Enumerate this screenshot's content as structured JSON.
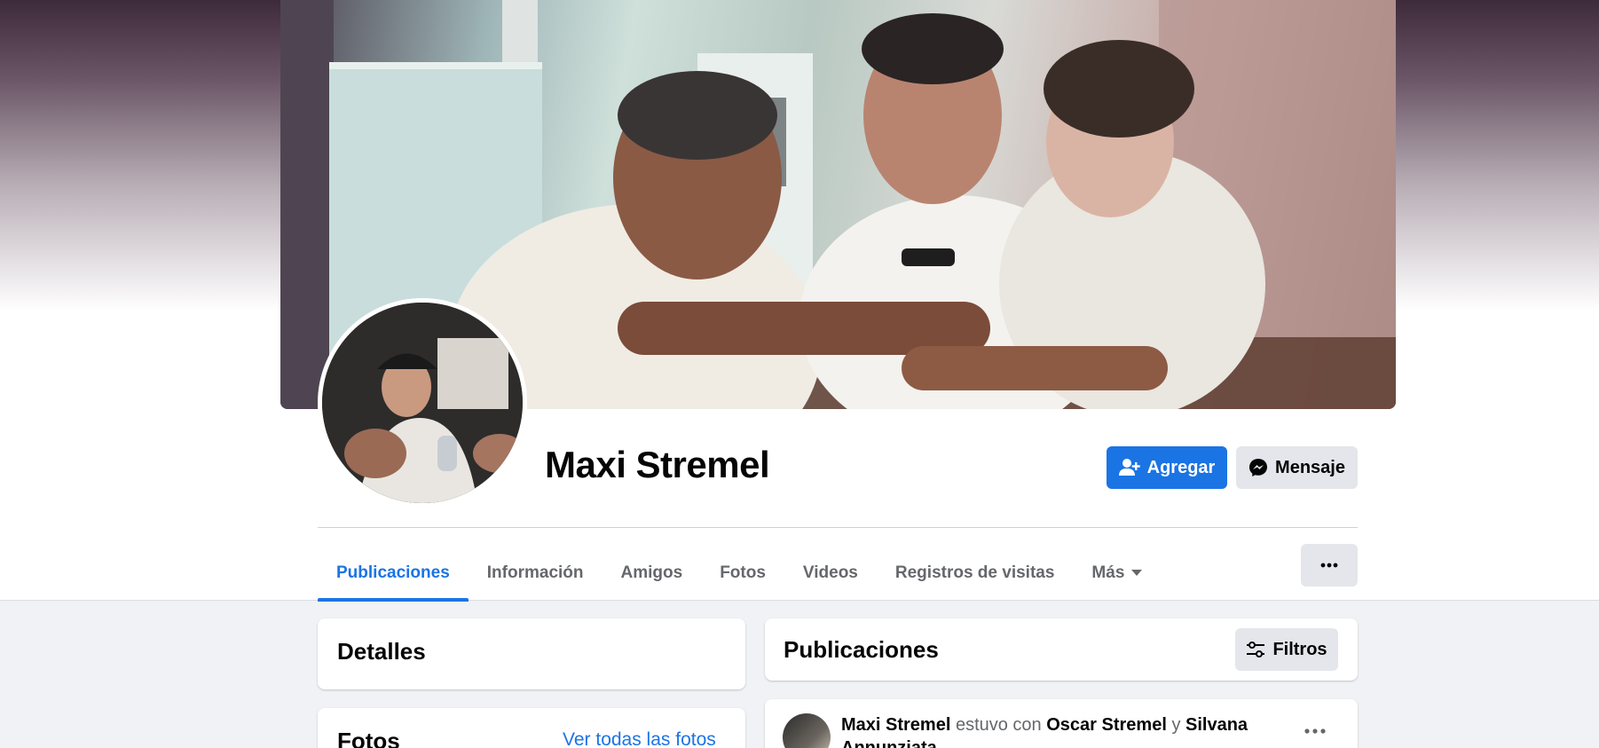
{
  "profile": {
    "name": "Maxi Stremel",
    "add_label": "Agregar",
    "message_label": "Mensaje"
  },
  "tabs": [
    {
      "label": "Publicaciones",
      "active": true
    },
    {
      "label": "Información",
      "active": false
    },
    {
      "label": "Amigos",
      "active": false
    },
    {
      "label": "Fotos",
      "active": false
    },
    {
      "label": "Videos",
      "active": false
    },
    {
      "label": "Registros de visitas",
      "active": false
    },
    {
      "label": "Más",
      "active": false
    }
  ],
  "details": {
    "title": "Detalles"
  },
  "photos": {
    "title": "Fotos",
    "link": "Ver todas las fotos"
  },
  "posts": {
    "title": "Publicaciones",
    "filter_label": "Filtros",
    "first_post": {
      "author": "Maxi Stremel",
      "verb": "estuvo con",
      "tag1": "Oscar Stremel",
      "conj": "y",
      "tag2": "Silvana",
      "tag2_cont": "Annunziata"
    }
  },
  "colors": {
    "accent": "#1b74e4",
    "page_bg": "#f0f2f5",
    "button_gray": "#e4e6eb"
  },
  "icons": [
    "add-friend-icon",
    "messenger-icon",
    "caret-down-icon",
    "ellipsis-icon",
    "filter-sliders-icon"
  ]
}
